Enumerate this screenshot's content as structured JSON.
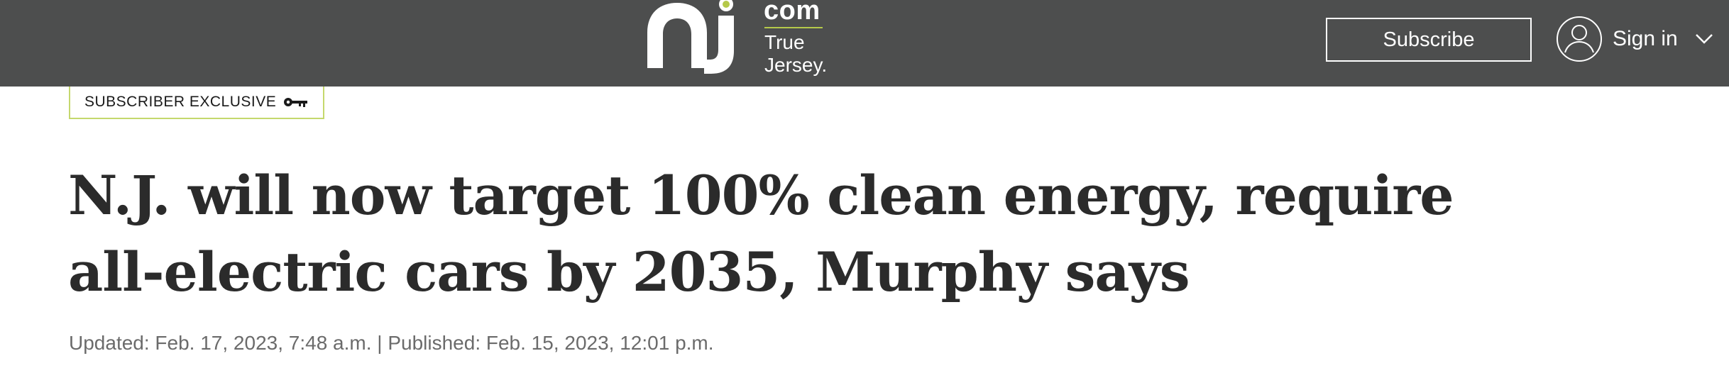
{
  "header": {
    "logo": {
      "mark_text": "nj",
      "com_text": "com",
      "tagline_line1": "True",
      "tagline_line2": "Jersey.",
      "accent_color": "#b5c94a"
    },
    "subscribe_label": "Subscribe",
    "signin_label": "Sign in",
    "background_color": "#4d4e4e",
    "icons": [
      "avatar-icon",
      "chevron-down-icon"
    ]
  },
  "article": {
    "badge_label": "SUBSCRIBER EXCLUSIVE",
    "badge_icon": "key-icon",
    "badge_border_color": "#c5d86d",
    "headline": "N.J. will now target 100% clean energy, require all-electric cars by 2035, Murphy says",
    "dateline": "Updated: Feb. 17, 2023, 7:48 a.m. | Published: Feb. 15, 2023, 12:01 p.m."
  }
}
